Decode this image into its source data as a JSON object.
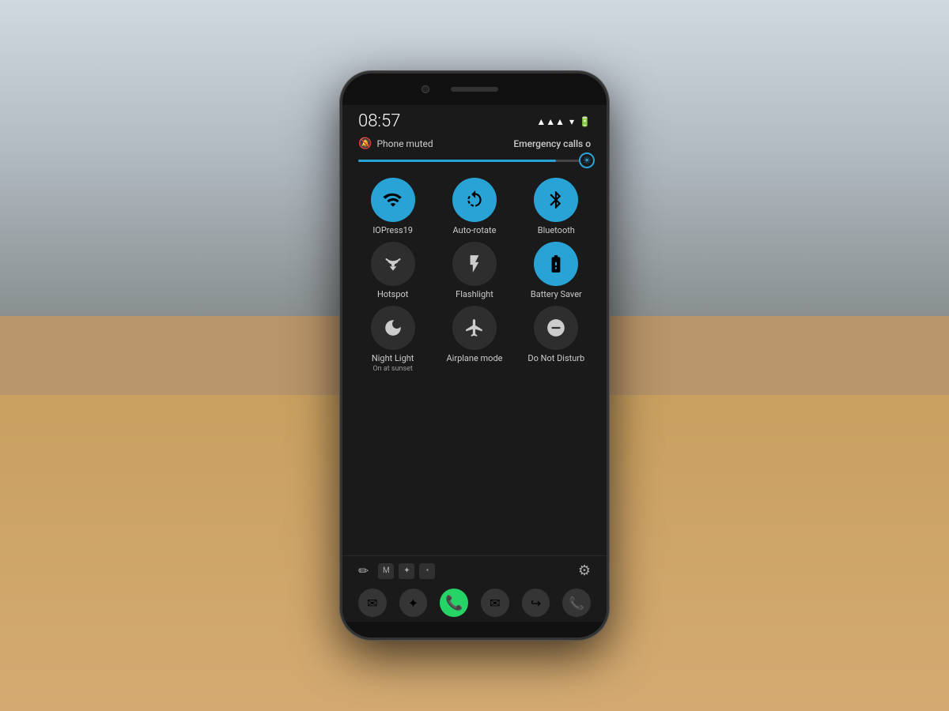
{
  "background": {
    "color": "#b8956a"
  },
  "phone": {
    "status_bar": {
      "time": "08:57",
      "muted_label": "Phone muted",
      "emergency_label": "Emergency calls o"
    },
    "brightness": {
      "fill_percent": 85
    },
    "quick_settings": {
      "rows": [
        [
          {
            "id": "wifi",
            "label": "IOPress19",
            "sublabel": "",
            "active": true,
            "icon": "wifi"
          },
          {
            "id": "autorotate",
            "label": "Auto-rotate",
            "sublabel": "",
            "active": true,
            "icon": "autorotate"
          },
          {
            "id": "bluetooth",
            "label": "Bluetooth",
            "sublabel": "",
            "active": true,
            "icon": "bluetooth"
          }
        ],
        [
          {
            "id": "hotspot",
            "label": "Hotspot",
            "sublabel": "",
            "active": false,
            "icon": "hotspot"
          },
          {
            "id": "flashlight",
            "label": "Flashlight",
            "sublabel": "",
            "active": false,
            "icon": "flashlight"
          },
          {
            "id": "battery_saver",
            "label": "Battery Saver",
            "sublabel": "",
            "active": true,
            "icon": "battery"
          }
        ],
        [
          {
            "id": "night_light",
            "label": "Night Light",
            "sublabel": "On at sunset",
            "active": false,
            "icon": "nightlight"
          },
          {
            "id": "airplane",
            "label": "Airplane mode",
            "sublabel": "",
            "active": false,
            "icon": "airplane"
          },
          {
            "id": "dnd",
            "label": "Do Not Disturb",
            "sublabel": "",
            "active": false,
            "icon": "dnd"
          }
        ]
      ]
    },
    "bottom_bar": {
      "edit_icon": "✏",
      "settings_icon": "⚙"
    },
    "nav_icons": [
      "✉",
      "✦",
      "•"
    ]
  }
}
